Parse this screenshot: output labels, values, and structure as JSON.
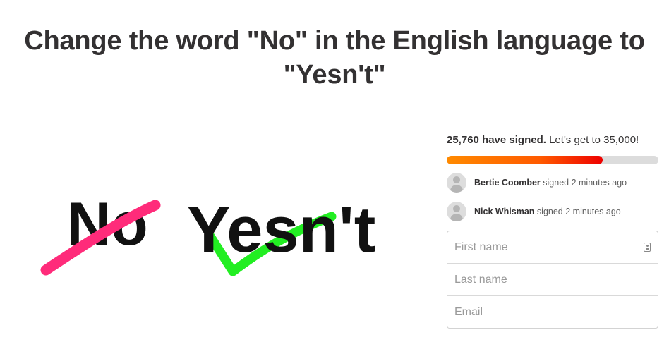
{
  "page": {
    "title_line1": "Change the word \"No\" in the English language to",
    "title_line2": "\"Yesn't\""
  },
  "hero": {
    "word_crossed": "No",
    "word_new": "Yesn't",
    "strike_color": "#ff2b7a",
    "check_color": "#22ee22",
    "ink_color": "#111111"
  },
  "progress": {
    "signed_count_text": "25,760 have signed.",
    "goal_text": "Let's get to 35,000!",
    "signed": 25760,
    "goal": 35000,
    "fill_colors": [
      "#ff8a00",
      "#ee0000"
    ]
  },
  "signers": [
    {
      "name": "Bertie Coomber",
      "action": "signed 2 minutes ago",
      "icon": "avatar-placeholder-icon"
    },
    {
      "name": "Nick Whisman",
      "action": "signed 2 minutes ago",
      "icon": "avatar-placeholder-icon"
    }
  ],
  "form": {
    "first_name_placeholder": "First name",
    "first_name_value": "",
    "last_name_placeholder": "Last name",
    "last_name_value": "",
    "email_placeholder": "Email",
    "email_value": "",
    "autofill_icon": "contact-card-icon"
  }
}
